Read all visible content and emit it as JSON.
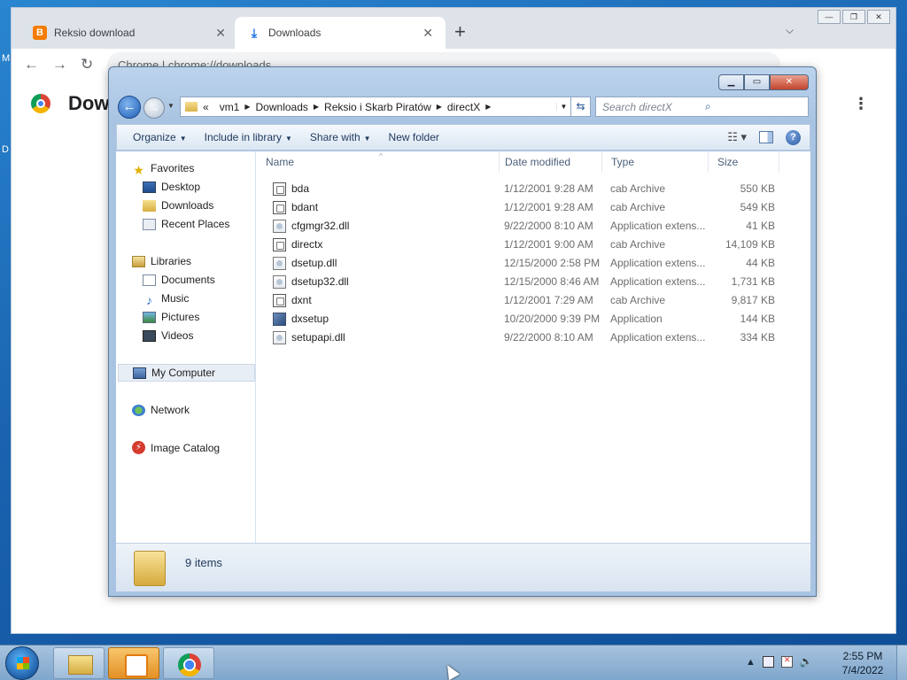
{
  "desktop": {
    "edge_letters": [
      "M",
      "D"
    ]
  },
  "chrome": {
    "tabs": [
      {
        "title": "Reksio download",
        "close": "✕"
      },
      {
        "title": "Downloads",
        "close": "✕"
      }
    ],
    "new_tab": "+",
    "tab_search": "⌄",
    "omnibox_text": "Chrome | chrome://downloads",
    "page_title": "Downl",
    "menu": "⋮",
    "window_buttons": [
      "—",
      "❐",
      "✕"
    ]
  },
  "explorer": {
    "window_buttons": {
      "minimize": "▁",
      "maximize": "▭",
      "close": "✕"
    },
    "address": {
      "overflow": "«",
      "segments": [
        "vm1",
        "Downloads",
        "Reksio i Skarb Piratów",
        "directX"
      ]
    },
    "search_placeholder": "Search directX",
    "commands": {
      "organize": "Organize",
      "include_in_library": "Include in library",
      "share_with": "Share with",
      "new_folder": "New folder"
    },
    "nav": {
      "favorites": "Favorites",
      "desktop": "Desktop",
      "downloads": "Downloads",
      "recent_places": "Recent Places",
      "libraries": "Libraries",
      "documents": "Documents",
      "music": "Music",
      "pictures": "Pictures",
      "videos": "Videos",
      "my_computer": "My Computer",
      "network": "Network",
      "image_catalog": "Image Catalog"
    },
    "columns": {
      "name": "Name",
      "date_modified": "Date modified",
      "type": "Type",
      "size": "Size"
    },
    "files": [
      {
        "name": "bda",
        "date": "1/12/2001 9:28 AM",
        "type": "cab Archive",
        "size": "550 KB",
        "icon": "cab-icon"
      },
      {
        "name": "bdant",
        "date": "1/12/2001 9:28 AM",
        "type": "cab Archive",
        "size": "549 KB",
        "icon": "cab-icon"
      },
      {
        "name": "cfgmgr32.dll",
        "date": "9/22/2000 8:10 AM",
        "type": "Application extens...",
        "size": "41 KB",
        "icon": "dll-icon"
      },
      {
        "name": "directx",
        "date": "1/12/2001 9:00 AM",
        "type": "cab Archive",
        "size": "14,109 KB",
        "icon": "cab-icon"
      },
      {
        "name": "dsetup.dll",
        "date": "12/15/2000 2:58 PM",
        "type": "Application extens...",
        "size": "44 KB",
        "icon": "dll-icon"
      },
      {
        "name": "dsetup32.dll",
        "date": "12/15/2000 8:46 AM",
        "type": "Application extens...",
        "size": "1,731 KB",
        "icon": "dll-icon"
      },
      {
        "name": "dxnt",
        "date": "1/12/2001 7:29 AM",
        "type": "cab Archive",
        "size": "9,817 KB",
        "icon": "cab-icon"
      },
      {
        "name": "dxsetup",
        "date": "10/20/2000 9:39 PM",
        "type": "Application",
        "size": "144 KB",
        "icon": "app-icon"
      },
      {
        "name": "setupapi.dll",
        "date": "9/22/2000 8:10 AM",
        "type": "Application extens...",
        "size": "334 KB",
        "icon": "dll-icon"
      }
    ],
    "status": "9 items"
  },
  "taskbar": {
    "time": "2:55 PM",
    "date": "7/4/2022",
    "tray_arrow": "▲"
  }
}
